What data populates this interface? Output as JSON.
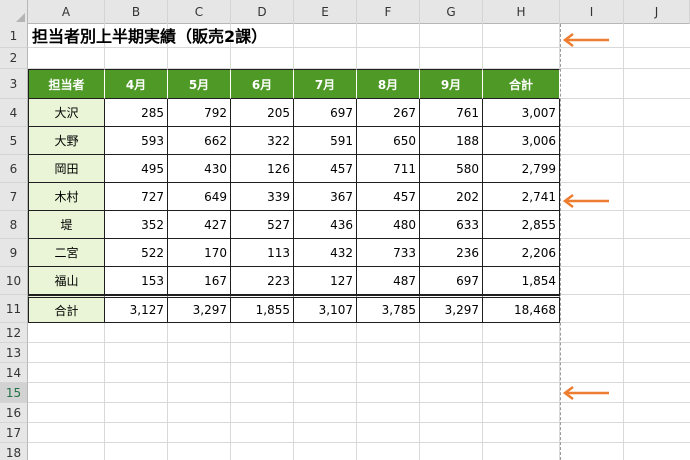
{
  "sheet": {
    "columns": [
      "A",
      "B",
      "C",
      "D",
      "E",
      "F",
      "G",
      "H",
      "I",
      "J"
    ],
    "rows": [
      "1",
      "2",
      "3",
      "4",
      "5",
      "6",
      "7",
      "8",
      "9",
      "10",
      "11",
      "12",
      "13",
      "14",
      "15",
      "16",
      "17",
      "18"
    ],
    "active_row": "15",
    "title": "担当者別上半期実績（販売2課）",
    "table": {
      "headers": [
        "担当者",
        "4月",
        "5月",
        "6月",
        "7月",
        "8月",
        "9月",
        "合計"
      ],
      "rows": [
        [
          "大沢",
          "285",
          "792",
          "205",
          "697",
          "267",
          "761",
          "3,007"
        ],
        [
          "大野",
          "593",
          "662",
          "322",
          "591",
          "650",
          "188",
          "3,006"
        ],
        [
          "岡田",
          "495",
          "430",
          "126",
          "457",
          "711",
          "580",
          "2,799"
        ],
        [
          "木村",
          "727",
          "649",
          "339",
          "367",
          "457",
          "202",
          "2,741"
        ],
        [
          "堤",
          "352",
          "427",
          "527",
          "436",
          "480",
          "633",
          "2,855"
        ],
        [
          "二宮",
          "522",
          "170",
          "113",
          "432",
          "733",
          "236",
          "2,206"
        ],
        [
          "福山",
          "153",
          "167",
          "223",
          "127",
          "487",
          "697",
          "1,854"
        ]
      ],
      "total": [
        "合計",
        "3,127",
        "3,297",
        "1,855",
        "3,107",
        "3,785",
        "3,297",
        "18,468"
      ]
    },
    "header_color": "#4f9a27",
    "name_fill_color": "#e9f5d6",
    "arrow_color": "#ed7d31",
    "arrow_icon": "arrow-left-icon"
  }
}
